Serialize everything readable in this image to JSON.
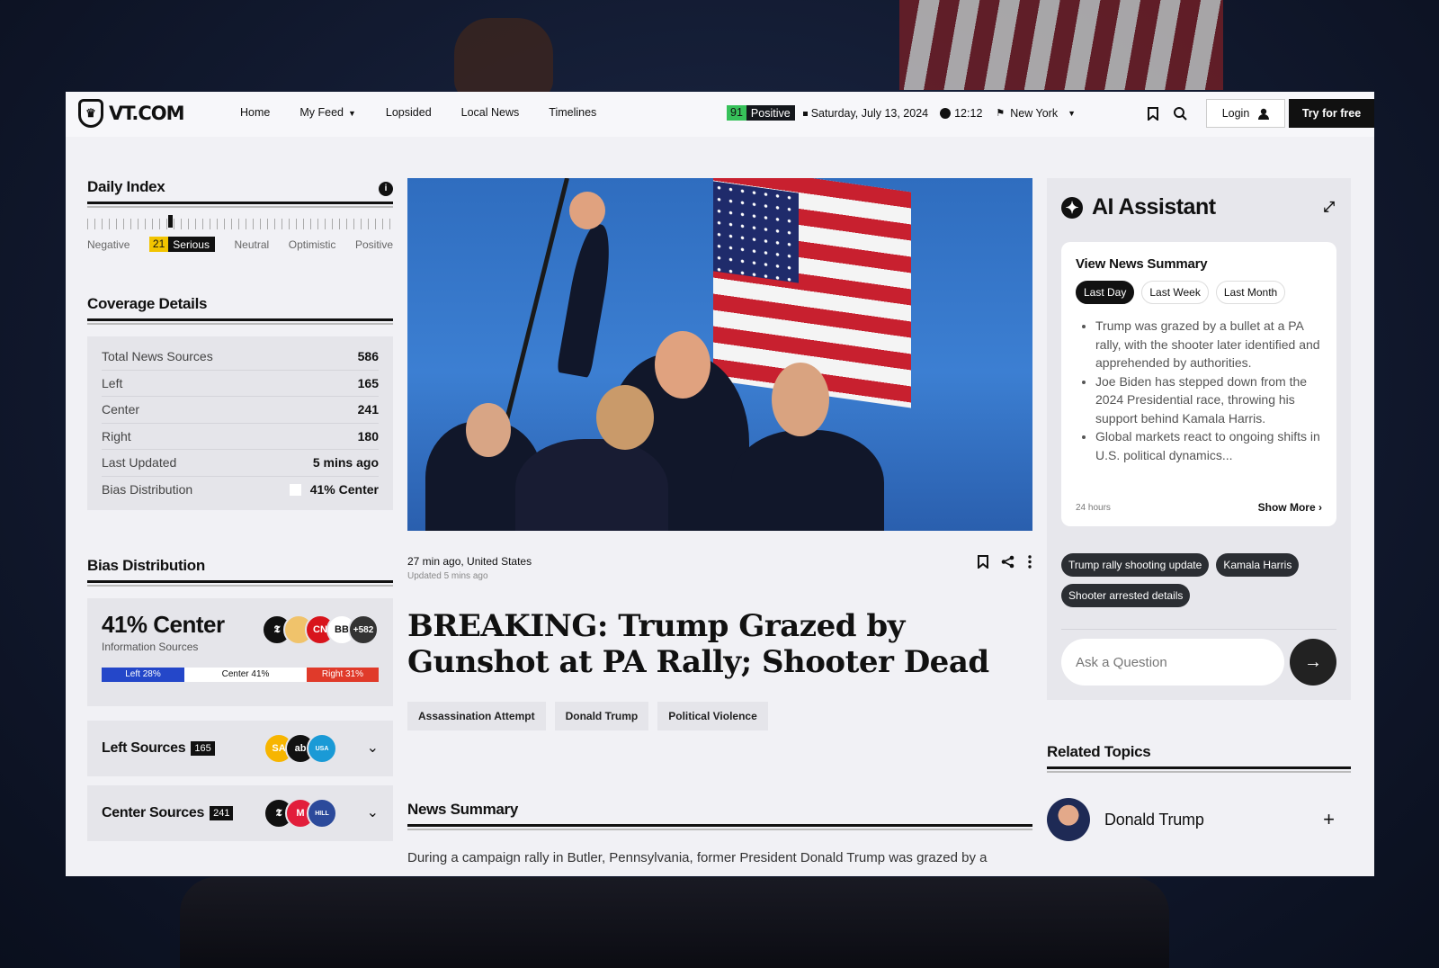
{
  "nav": {
    "logo": "VT.COM",
    "links": [
      {
        "label": "Home"
      },
      {
        "label": "My Feed",
        "dropdown": true
      },
      {
        "label": "Lopsided"
      },
      {
        "label": "Local News"
      },
      {
        "label": "Timelines"
      }
    ],
    "score": {
      "value": "91",
      "label": "Positive",
      "color": "#37c15a"
    },
    "date": "Saturday, July 13, 2024",
    "time": "12:12",
    "city": "New York",
    "login_label": "Login",
    "try_label": "Try for free"
  },
  "daily_index": {
    "title": "Daily Index",
    "scale": [
      "Negative",
      "Serious",
      "Neutral",
      "Optimistic",
      "Positive"
    ],
    "active_value": "21",
    "active_label": "Serious",
    "active_color": "#f2c400"
  },
  "coverage": {
    "title": "Coverage Details",
    "rows": [
      {
        "label": "Total News Sources",
        "value": "586"
      },
      {
        "label": "Left",
        "value": "165"
      },
      {
        "label": "Center",
        "value": "241"
      },
      {
        "label": "Right",
        "value": "180"
      },
      {
        "label": "Last Updated",
        "value": "5 mins ago"
      },
      {
        "label": "Bias Distribution",
        "value": "41% Center"
      }
    ]
  },
  "bias": {
    "title": "Bias Distribution",
    "headline": "41% Center",
    "sub": "Information Sources",
    "more_count": "+582",
    "bar": {
      "left": "Left 28%",
      "center": "Center 41%",
      "right": "Right 31%"
    },
    "colors": {
      "left": "#2447c9",
      "right": "#e03a2a"
    },
    "left_sources": {
      "label": "Left Sources",
      "count": "165"
    },
    "center_sources": {
      "label": "Center Sources",
      "count": "241"
    }
  },
  "article": {
    "meta": "27 min ago, United States",
    "updated": "Updated 5 mins ago",
    "headline": "BREAKING: Trump Grazed by Gunshot at PA Rally; Shooter Dead",
    "tags": [
      "Assassination Attempt",
      "Donald Trump",
      "Political Violence"
    ],
    "summary_title": "News Summary",
    "summary_text": "During a campaign rally in Butler, Pennsylvania, former President Donald Trump was grazed by a"
  },
  "ai": {
    "title": "AI Assistant",
    "summary_title": "View News Summary",
    "tabs": [
      {
        "label": "Last Day",
        "active": true
      },
      {
        "label": "Last Week"
      },
      {
        "label": "Last Month"
      }
    ],
    "bullets": [
      "Trump was grazed by a bullet at a PA rally, with the shooter later identified and apprehended by authorities.",
      "Joe Biden has stepped down from the 2024 Presidential race, throwing his support behind Kamala Harris.",
      "Global markets react to ongoing shifts in U.S. political dynamics..."
    ],
    "hours": "24 hours",
    "show_more": "Show More",
    "chips": [
      "Trump rally shooting update",
      "Kamala Harris",
      "Shooter arrested details"
    ],
    "ask_placeholder": "Ask a Question"
  },
  "related": {
    "title": "Related Topics",
    "topics": [
      {
        "name": "Donald Trump"
      }
    ]
  }
}
